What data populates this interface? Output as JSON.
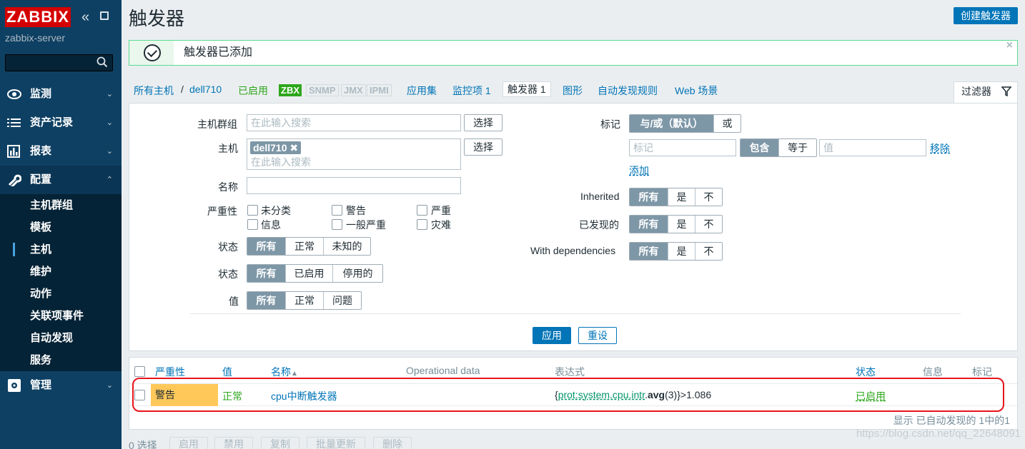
{
  "sidebar": {
    "logo": "ZABBIX",
    "server_name": "zabbix-server",
    "menu": [
      {
        "label": "监测",
        "icon": "eye-icon"
      },
      {
        "label": "资产记录",
        "icon": "list-icon"
      },
      {
        "label": "报表",
        "icon": "bar-chart-icon"
      },
      {
        "label": "配置",
        "icon": "wrench-icon"
      },
      {
        "label": "管理",
        "icon": "gear-icon"
      }
    ],
    "config_submenu": [
      "主机群组",
      "模板",
      "主机",
      "维护",
      "动作",
      "关联项事件",
      "自动发现",
      "服务"
    ]
  },
  "header": {
    "title": "触发器",
    "create_button": "创建触发器"
  },
  "message": {
    "text": "触发器已添加",
    "close": "×"
  },
  "host_nav": {
    "all_hosts": "所有主机",
    "separator": "/",
    "host": "dell710",
    "status": "已启用",
    "tags": [
      "ZBX",
      "SNMP",
      "JMX",
      "IPMI"
    ],
    "applications": "应用集",
    "items": "监控项 1",
    "triggers": "触发器 1",
    "graphs": "图形",
    "discovery": "自动发现规则",
    "web": "Web 场景"
  },
  "filter": {
    "tab_label": "过滤器",
    "host_group_label": "主机群组",
    "host_group_placeholder": "在此输入搜索",
    "select_button": "选择",
    "host_label": "主机",
    "host_chip": "dell710",
    "host_placeholder": "在此输入搜索",
    "name_label": "名称",
    "severity_label": "严重性",
    "severities": [
      "未分类",
      "警告",
      "严重",
      "信息",
      "一般严重",
      "灾难"
    ],
    "state_label": "状态",
    "state_options": [
      "所有",
      "正常",
      "未知的"
    ],
    "status_label": "状态",
    "status_options": [
      "所有",
      "已启用",
      "停用的"
    ],
    "value_label": "值",
    "value_options": [
      "所有",
      "正常",
      "问题"
    ],
    "tags_label": "标记",
    "tags_eval": [
      "与/或（默认）",
      "或"
    ],
    "tag_placeholder": "标记",
    "tag_operator": [
      "包含",
      "等于"
    ],
    "tag_value_placeholder": "值",
    "remove": "移除",
    "add": "添加",
    "inherited_label": "Inherited",
    "inherited_options": [
      "所有",
      "是",
      "不"
    ],
    "discovered_label": "已发现的",
    "discovered_options": [
      "所有",
      "是",
      "不"
    ],
    "dependencies_label": "With dependencies",
    "dependencies_options": [
      "所有",
      "是",
      "不"
    ],
    "apply": "应用",
    "reset": "重设"
  },
  "table": {
    "headers": {
      "severity": "严重性",
      "value": "值",
      "name": "名称",
      "sort_arrow": "▲",
      "opdata": "Operational data",
      "expression": "表达式",
      "status": "状态",
      "info": "信息",
      "tags": "标记"
    },
    "rows": [
      {
        "severity": "警告",
        "value": "正常",
        "name": "cpu中断触发器",
        "expr_open": "{",
        "expr_host_key": "prot:system.cpu.intr",
        "expr_dot": ".",
        "expr_func": "avg",
        "expr_args": "(3)}",
        "expr_tail": ">1.086",
        "status": "已启用"
      }
    ],
    "footer": "显示 已自动发现的 1中的1"
  },
  "bottom": {
    "selected": "0 选择",
    "buttons": [
      "启用",
      "禁用",
      "复制",
      "批量更新",
      "删除"
    ]
  },
  "watermark": "https://blog.csdn.net/qq_22648091",
  "colors": {
    "sidebar": "#0e4063",
    "accent": "#0275b8",
    "warning": "#ffc859",
    "enabled": "#2da71c",
    "highlight": "#e8141c"
  }
}
